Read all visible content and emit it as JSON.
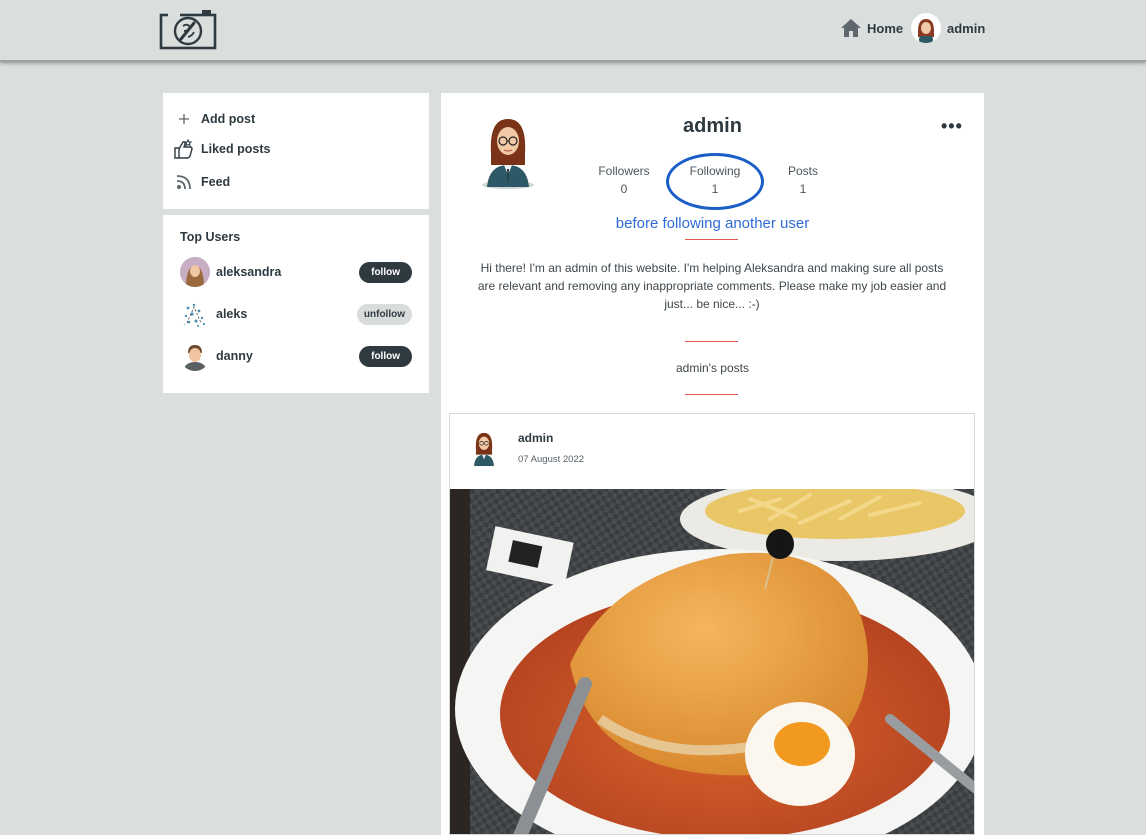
{
  "navbar": {
    "home_label": "Home",
    "user_label": "admin"
  },
  "menu": {
    "add_post": "Add post",
    "liked_posts": "Liked posts",
    "feed": "Feed"
  },
  "top_users": {
    "title": "Top Users",
    "users": [
      {
        "name": "aleksandra",
        "action": "follow"
      },
      {
        "name": "aleks",
        "action": "unfollow"
      },
      {
        "name": "danny",
        "action": "follow"
      }
    ]
  },
  "profile": {
    "username": "admin",
    "stats": [
      {
        "label": "Followers",
        "value": "0"
      },
      {
        "label": "Following",
        "value": "1"
      },
      {
        "label": "Posts",
        "value": "1"
      }
    ],
    "annotation": "before following another user",
    "bio": "Hi there! I'm an admin of this website. I'm helping Aleksandra and making sure all posts are relevant and removing any inappropriate comments. Please make my job easier and just... be nice... :-)",
    "posts_heading": "admin's posts"
  },
  "post": {
    "author": "admin",
    "date": "07 August 2022"
  },
  "colors": {
    "background": "#dadfdd",
    "dark": "#2f3a40",
    "annotation_blue": "#1b5ec8",
    "divider_red": "#e0574f"
  }
}
